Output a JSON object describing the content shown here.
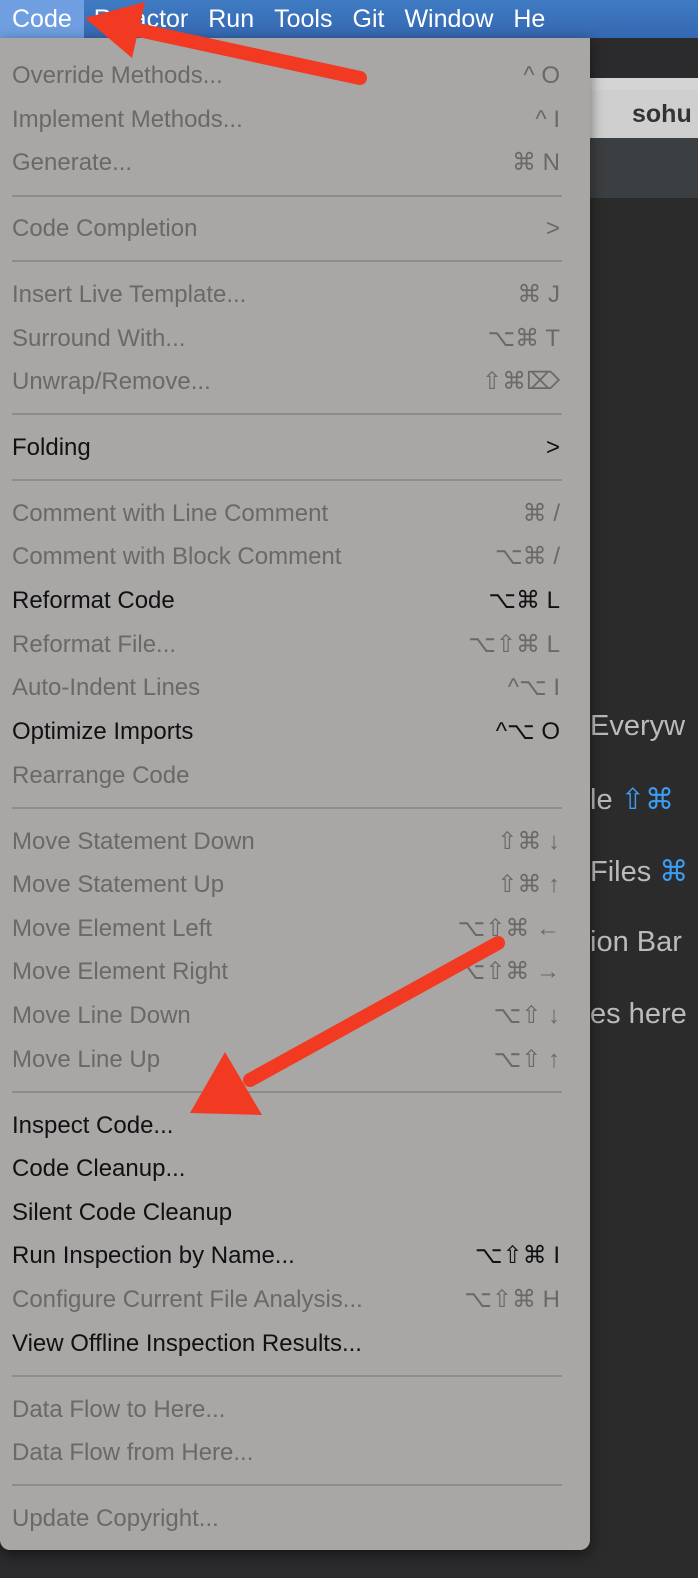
{
  "menubar": {
    "items": [
      "Code",
      "Refactor",
      "Run",
      "Tools",
      "Git",
      "Window",
      "He"
    ]
  },
  "ide": {
    "tab_label": "sohu",
    "hints": [
      {
        "text": "Everyw",
        "key": ""
      },
      {
        "text": "le ",
        "key": "⇧⌘"
      },
      {
        "text": "Files ",
        "key": "⌘"
      },
      {
        "text": "ion Bar",
        "key": ""
      },
      {
        "text": "es here",
        "key": ""
      }
    ]
  },
  "menu": {
    "items": [
      {
        "label": "Override Methods...",
        "shortcut": "^ O",
        "enabled": false
      },
      {
        "label": "Implement Methods...",
        "shortcut": "^ I",
        "enabled": false
      },
      {
        "label": "Generate...",
        "shortcut": "⌘ N",
        "enabled": false
      },
      {
        "label": "Code Completion",
        "shortcut": ">",
        "enabled": false
      },
      {
        "label": "Insert Live Template...",
        "shortcut": "⌘ J",
        "enabled": false
      },
      {
        "label": "Surround With...",
        "shortcut": "⌥⌘ T",
        "enabled": false
      },
      {
        "label": "Unwrap/Remove...",
        "shortcut": "⇧⌘⌦",
        "enabled": false
      },
      {
        "label": "Folding",
        "shortcut": ">",
        "enabled": true
      },
      {
        "label": "Comment with Line Comment",
        "shortcut": "⌘ /",
        "enabled": false
      },
      {
        "label": "Comment with Block Comment",
        "shortcut": "⌥⌘ /",
        "enabled": false
      },
      {
        "label": "Reformat Code",
        "shortcut": "⌥⌘ L",
        "enabled": true
      },
      {
        "label": "Reformat File...",
        "shortcut": "⌥⇧⌘ L",
        "enabled": false
      },
      {
        "label": "Auto-Indent Lines",
        "shortcut": "^⌥ I",
        "enabled": false
      },
      {
        "label": "Optimize Imports",
        "shortcut": "^⌥ O",
        "enabled": true
      },
      {
        "label": "Rearrange Code",
        "shortcut": "",
        "enabled": false
      },
      {
        "label": "Move Statement Down",
        "shortcut": "⇧⌘ ↓",
        "enabled": false
      },
      {
        "label": "Move Statement Up",
        "shortcut": "⇧⌘ ↑",
        "enabled": false
      },
      {
        "label": "Move Element Left",
        "shortcut": "⌥⇧⌘ ←",
        "enabled": false
      },
      {
        "label": "Move Element Right",
        "shortcut": "⌥⇧⌘ →",
        "enabled": false
      },
      {
        "label": "Move Line Down",
        "shortcut": "⌥⇧ ↓",
        "enabled": false
      },
      {
        "label": "Move Line Up",
        "shortcut": "⌥⇧ ↑",
        "enabled": false
      },
      {
        "label": "Inspect Code...",
        "shortcut": "",
        "enabled": true
      },
      {
        "label": "Code Cleanup...",
        "shortcut": "",
        "enabled": true
      },
      {
        "label": "Silent Code Cleanup",
        "shortcut": "",
        "enabled": true
      },
      {
        "label": "Run Inspection by Name...",
        "shortcut": "⌥⇧⌘ I",
        "enabled": true
      },
      {
        "label": "Configure Current File Analysis...",
        "shortcut": "⌥⇧⌘ H",
        "enabled": false
      },
      {
        "label": "View Offline Inspection Results...",
        "shortcut": "",
        "enabled": true
      },
      {
        "label": "Data Flow to Here...",
        "shortcut": "",
        "enabled": false
      },
      {
        "label": "Data Flow from Here...",
        "shortcut": "",
        "enabled": false
      },
      {
        "label": "Update Copyright...",
        "shortcut": "",
        "enabled": false
      }
    ]
  },
  "colors": {
    "annotation_arrow": "#f23a22",
    "menubar": "#3568b2",
    "menu_bg": "#a9a6a6"
  }
}
